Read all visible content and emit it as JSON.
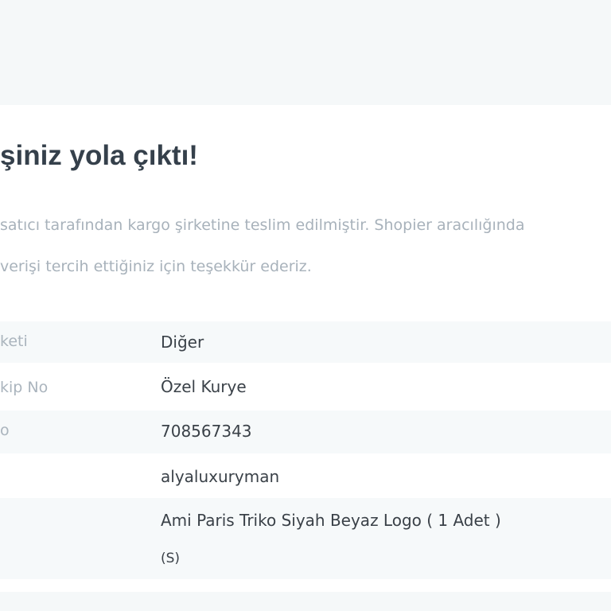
{
  "header": {
    "title": "şiniz yola çıktı!"
  },
  "message": {
    "line1": "satıcı tarafından kargo şirketine teslim edilmiştir. Shopier aracılığında",
    "line2": "verişi tercih ettiğiniz için teşekkür ederiz."
  },
  "details": {
    "rows": [
      {
        "label": "keti",
        "value": "Diğer"
      },
      {
        "label": "kip No",
        "value": "Özel Kurye"
      },
      {
        "label": "o",
        "value": "708567343"
      },
      {
        "label": "",
        "value": "alyaluxuryman"
      },
      {
        "label": "",
        "value": "Ami Paris Triko Siyah Beyaz Logo ( 1 Adet )",
        "sub": "(S)"
      }
    ]
  }
}
